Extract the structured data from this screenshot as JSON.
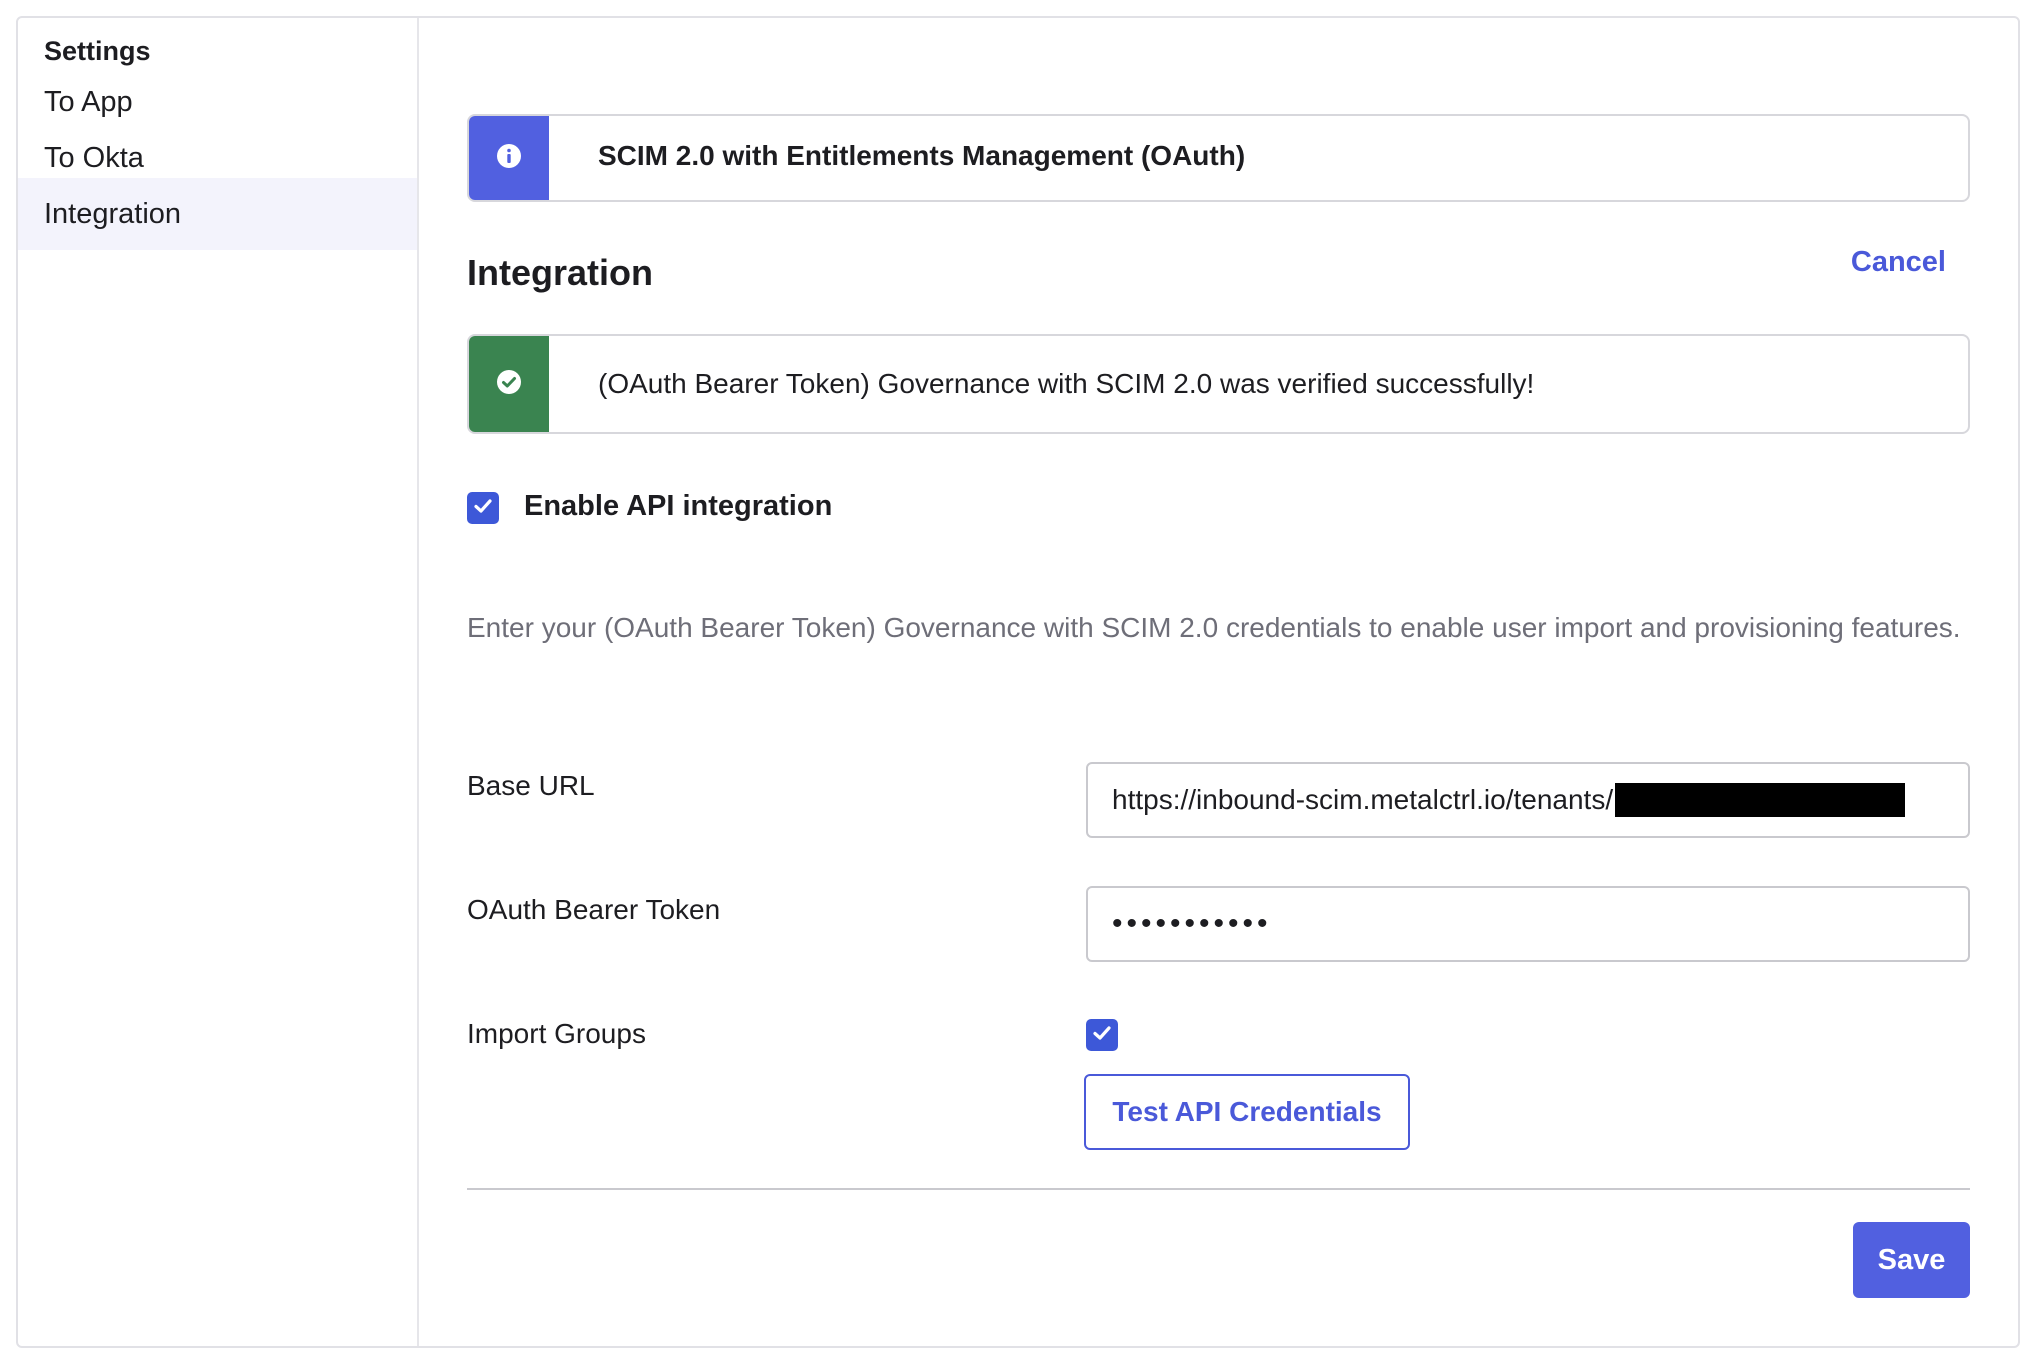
{
  "sidebar": {
    "heading": "Settings",
    "items": [
      {
        "label": "To App",
        "active": false
      },
      {
        "label": "To Okta",
        "active": false
      },
      {
        "label": "Integration",
        "active": true
      }
    ]
  },
  "info_banner": {
    "icon": "info-icon",
    "text": "SCIM 2.0 with Entitlements Management (OAuth)"
  },
  "section": {
    "title": "Integration",
    "cancel_label": "Cancel"
  },
  "success_banner": {
    "icon": "check-circle-icon",
    "text": "(OAuth Bearer Token) Governance with SCIM 2.0 was verified successfully!"
  },
  "enable_api": {
    "label": "Enable API integration",
    "checked": true
  },
  "description": "Enter your (OAuth Bearer Token) Governance with SCIM 2.0 credentials to enable user import and provisioning features.",
  "fields": {
    "base_url": {
      "label": "Base URL",
      "value": "https://inbound-scim.metalctrl.io/tenants/"
    },
    "oauth_token": {
      "label": "OAuth Bearer Token",
      "value": "•••••••••••"
    },
    "import_groups": {
      "label": "Import Groups",
      "checked": true
    }
  },
  "buttons": {
    "test_label": "Test API Credentials",
    "save_label": "Save"
  },
  "colors": {
    "accent": "#5160e0",
    "success": "#3a8450",
    "checkbox": "#3d58d8"
  }
}
